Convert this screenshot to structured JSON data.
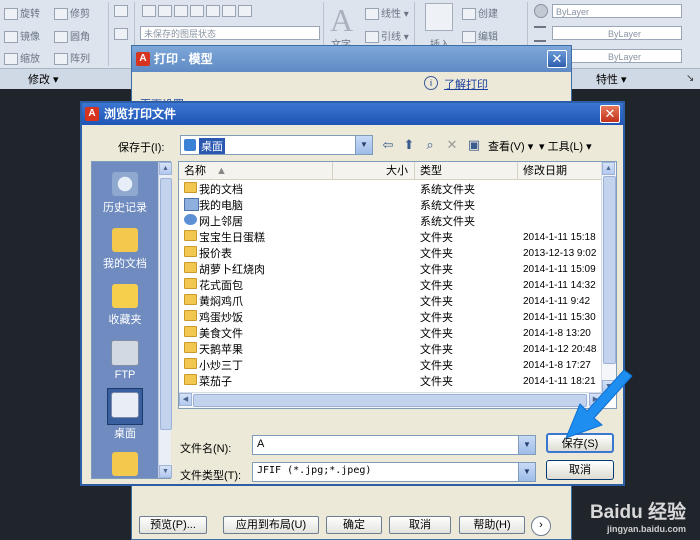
{
  "ribbon": {
    "tools_col1": [
      "旋转",
      "镜像",
      "缩放"
    ],
    "tools_col2": [
      "修剪",
      "圆角",
      "阵列"
    ],
    "layer_state": "未保存的图层状态",
    "text_tool": "文字",
    "linear_tool": "线性",
    "leader_tool": "引线",
    "insert_tool": "插入",
    "create_tool": "创建",
    "edit_tool": "编辑",
    "bylayer_1": "ByLayer",
    "bylayer_2": "ByLayer",
    "bylayer_3": "ByLayer",
    "modify_panel": "修改",
    "properties_panel": "特性"
  },
  "print_dialog": {
    "title": "打印 - 模型",
    "page_setup": "页面设置",
    "learn_print": "了解打印",
    "buttons": {
      "preview": "预览(P)...",
      "apply_layout": "应用到布局(U)",
      "ok": "确定",
      "cancel": "取消",
      "help": "帮助(H)"
    }
  },
  "browse_dialog": {
    "title": "浏览打印文件",
    "save_in_label": "保存于(I):",
    "save_in_value": "桌面",
    "views_label": "查看(V)",
    "tools_label": "工具(L)",
    "places": [
      "历史记录",
      "我的文档",
      "收藏夹",
      "FTP",
      "桌面"
    ],
    "columns": {
      "name": "名称",
      "size": "大小",
      "type": "类型",
      "modified": "修改日期"
    },
    "files": [
      {
        "name": "我的文档",
        "size": "",
        "type": "系统文件夹",
        "modified": "",
        "icon": "my-documents-icon"
      },
      {
        "name": "我的电脑",
        "size": "",
        "type": "系统文件夹",
        "modified": "",
        "icon": "computer-icon"
      },
      {
        "name": "网上邻居",
        "size": "",
        "type": "系统文件夹",
        "modified": "",
        "icon": "network-icon"
      },
      {
        "name": "宝宝生日蛋糕",
        "size": "",
        "type": "文件夹",
        "modified": "2014-1-11 15:18",
        "icon": "folder-icon"
      },
      {
        "name": "报价表",
        "size": "",
        "type": "文件夹",
        "modified": "2013-12-13 9:02",
        "icon": "folder-icon"
      },
      {
        "name": "胡萝卜红烧肉",
        "size": "",
        "type": "文件夹",
        "modified": "2014-1-11 15:09",
        "icon": "folder-icon"
      },
      {
        "name": "花式面包",
        "size": "",
        "type": "文件夹",
        "modified": "2014-1-11 14:32",
        "icon": "folder-icon"
      },
      {
        "name": "黄焖鸡爪",
        "size": "",
        "type": "文件夹",
        "modified": "2014-1-11 9:42",
        "icon": "folder-icon"
      },
      {
        "name": "鸡蛋炒饭",
        "size": "",
        "type": "文件夹",
        "modified": "2014-1-11 15:30",
        "icon": "folder-icon"
      },
      {
        "name": "美食文件",
        "size": "",
        "type": "文件夹",
        "modified": "2014-1-8 13:20",
        "icon": "folder-icon"
      },
      {
        "name": "天鹅苹果",
        "size": "",
        "type": "文件夹",
        "modified": "2014-1-12 20:48",
        "icon": "folder-icon"
      },
      {
        "name": "小炒三丁",
        "size": "",
        "type": "文件夹",
        "modified": "2014-1-8 17:27",
        "icon": "folder-icon"
      },
      {
        "name": "菜茄子",
        "size": "",
        "type": "文件夹",
        "modified": "2014-1-11 18:21",
        "icon": "folder-icon"
      }
    ],
    "filename_label": "文件名(N):",
    "filename_value": "A",
    "filetype_label": "文件类型(T):",
    "filetype_value": "JFIF (*.jpg;*.jpeg)",
    "save_button": "保存(S)",
    "cancel_button": "取消"
  },
  "watermark": "Baidu 经验",
  "watermark_url": "jingyan.baidu.com",
  "colors": {
    "title_blue": "#1f55b6",
    "canvas": "#20242b",
    "arrow": "#1e8ff0"
  }
}
